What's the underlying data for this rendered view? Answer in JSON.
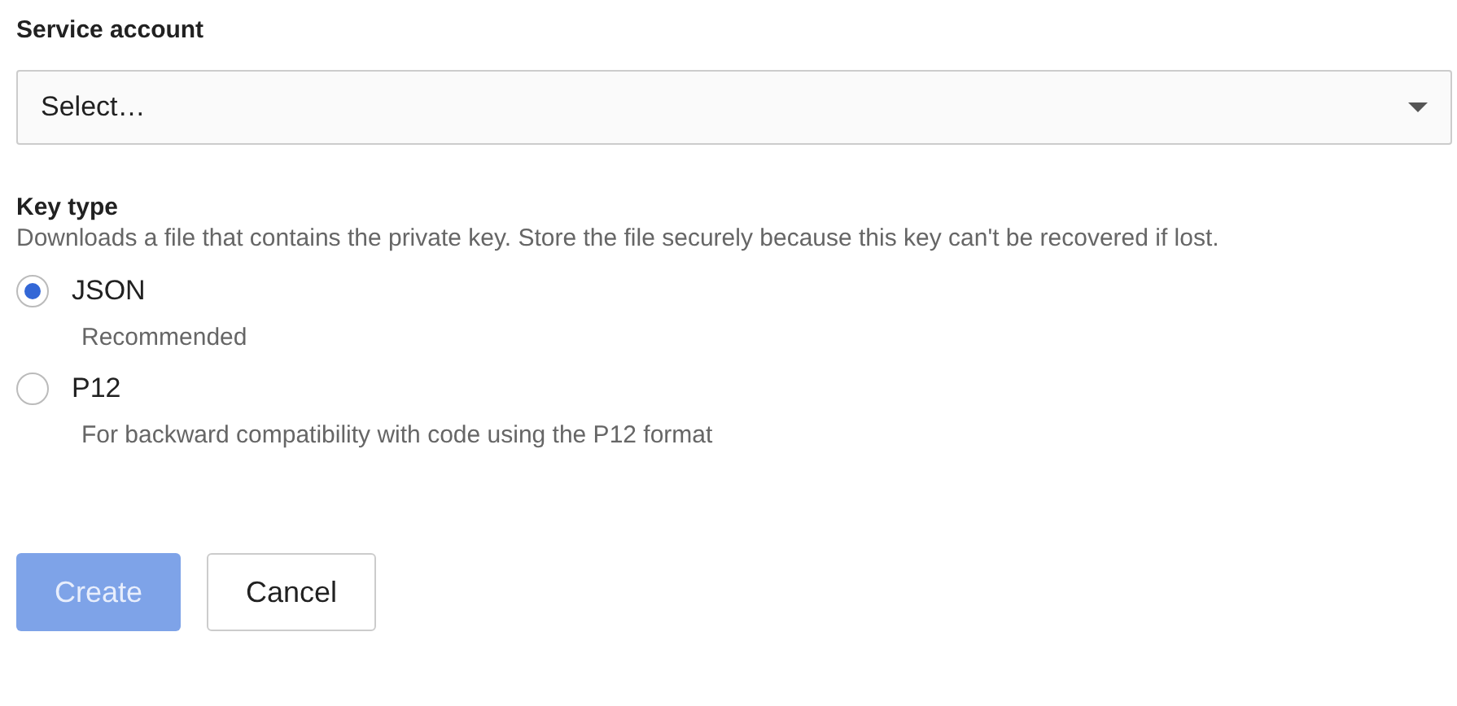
{
  "service_account": {
    "label": "Service account",
    "placeholder": "Select…"
  },
  "key_type": {
    "label": "Key type",
    "description": "Downloads a file that contains the private key. Store the file securely because this key can't be recovered if lost.",
    "options": [
      {
        "label": "JSON",
        "hint": "Recommended",
        "selected": true
      },
      {
        "label": "P12",
        "hint": "For backward compatibility with code using the P12 format",
        "selected": false
      }
    ]
  },
  "buttons": [
    {
      "label": "Create",
      "kind": "primary",
      "disabled": true
    },
    {
      "label": "Cancel",
      "kind": "secondary",
      "disabled": false
    }
  ]
}
